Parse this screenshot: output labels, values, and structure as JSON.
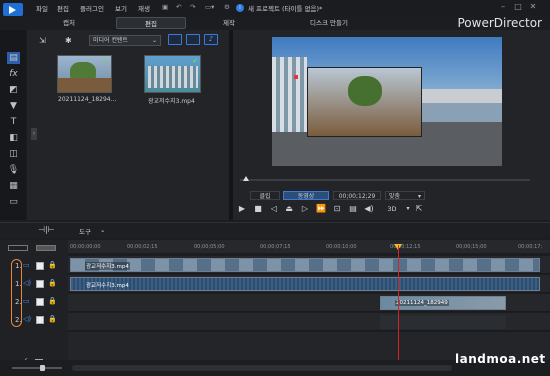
{
  "app": {
    "title": "새 프로젝트 (타이틀 없음)*",
    "brand": "PowerDirector"
  },
  "menu": [
    "파일",
    "편집",
    "플러그인",
    "보기",
    "재생"
  ],
  "main_tabs": [
    {
      "label": "캡처",
      "active": false
    },
    {
      "label": "편집",
      "active": true
    },
    {
      "label": "제작",
      "active": false
    },
    {
      "label": "디스크 만들기",
      "active": false
    }
  ],
  "library": {
    "dropdown": "미디어 컨텐트",
    "items": [
      {
        "name": "20211124_18294..."
      },
      {
        "name": "광교저수지3.mp4"
      }
    ]
  },
  "preview": {
    "clip_btn": "클립",
    "movie_btn": "동영상",
    "timecode": "00;00;12;29",
    "fit": "맞춤",
    "mode3d": "3D"
  },
  "timeline": {
    "tools_label": "도구",
    "ticks": [
      "00;00;00;00",
      "00;00;02;15",
      "00;00;05;00",
      "00;00;07;15",
      "00;00;10;00",
      "00;00;12;15",
      "00;00;15;00",
      "00;00;17;"
    ],
    "track_labels": [
      "1.",
      "1.",
      "2.",
      "2."
    ],
    "clips": [
      {
        "label": "광교저수지3.mp4",
        "track": 0
      },
      {
        "label": "광교저수지3.mp4",
        "track": 1
      },
      {
        "label": "20211124_182949",
        "track": 2
      }
    ]
  },
  "watermark": "landmoa.net",
  "colors": {
    "accent": "#3d7ad6",
    "playhead": "#d42525",
    "highlight": "#e8883a"
  }
}
